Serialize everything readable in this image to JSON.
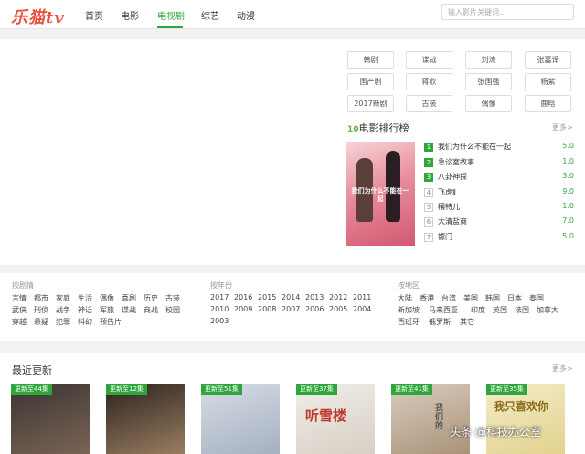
{
  "header": {
    "logo": "乐猫tv",
    "nav": [
      "首页",
      "电影",
      "电视剧",
      "综艺",
      "动漫"
    ],
    "active_nav": "电视剧",
    "search_placeholder": "输入影片关键词..."
  },
  "tags": [
    "韩剧",
    "谍战",
    "刘涛",
    "张嘉译",
    "国产剧",
    "蒋欣",
    "张国强",
    "杨紫",
    "2017新剧",
    "古装",
    "偶像",
    "鹿晗"
  ],
  "ranking": {
    "logo": "10",
    "title": "电影排行榜",
    "more": "更多>",
    "poster_text": "我们为什么不能在一起",
    "items": [
      {
        "num": "1",
        "name": "我们为什么不能在一起",
        "score": "5.0"
      },
      {
        "num": "2",
        "name": "急诊室故事",
        "score": "1.0"
      },
      {
        "num": "3",
        "name": "八卦神探",
        "score": "3.0"
      },
      {
        "num": "4",
        "name": "飞虎Ⅱ",
        "score": "9.0"
      },
      {
        "num": "5",
        "name": "穰特儿",
        "score": "1.0"
      },
      {
        "num": "6",
        "name": "大清盐商",
        "score": "7.0"
      },
      {
        "num": "7",
        "name": "镖门",
        "score": "5.0"
      }
    ]
  },
  "filters": {
    "by_genre": {
      "title": "按剧情",
      "rows": [
        [
          "言情",
          "都市",
          "家庭",
          "生活",
          "偶像",
          "喜剧",
          "历史",
          "古装"
        ],
        [
          "武侠",
          "刑侦",
          "战争",
          "神话",
          "军旅",
          "谍战",
          "商战",
          "校园"
        ],
        [
          "穿越",
          "悬疑",
          "犯罪",
          "科幻",
          "预告片"
        ]
      ]
    },
    "by_year": {
      "title": "按年份",
      "rows": [
        [
          "2017",
          "2016",
          "2015",
          "2014",
          "2013",
          "2012",
          "2011"
        ],
        [
          "2010",
          "2009",
          "2008",
          "2007",
          "2006",
          "2005",
          "2004"
        ],
        [
          "2003"
        ]
      ]
    },
    "by_region": {
      "title": "按地区",
      "rows": [
        [
          "大陆",
          "香港",
          "台湾",
          "美国",
          "韩国",
          "日本",
          "泰国"
        ],
        [
          "新加坡",
          "马来西亚",
          "印度",
          "英国",
          "法国",
          "加拿大"
        ],
        [
          "西班牙",
          "俄罗斯",
          "其它"
        ]
      ]
    }
  },
  "recent": {
    "title": "最近更新",
    "more": "更多>",
    "cards": [
      {
        "badge": "更新至44集",
        "colors": [
          "#3a3532",
          "#7a6455"
        ],
        "text": ""
      },
      {
        "badge": "更新至12集",
        "colors": [
          "#2b2320",
          "#9a7d60"
        ],
        "text": ""
      },
      {
        "badge": "更新至51集",
        "colors": [
          "#d8dde6",
          "#a5b0c0"
        ],
        "text": ""
      },
      {
        "badge": "更新至37集",
        "colors": [
          "#f1eee9",
          "#d6cfc4"
        ],
        "text": "听雪楼"
      },
      {
        "badge": "更新至41集",
        "colors": [
          "#d9cdbe",
          "#a99278"
        ],
        "text": "我们的"
      },
      {
        "badge": "更新至35集",
        "colors": [
          "#f4ecc8",
          "#e2d28f"
        ],
        "text": "我只喜欢你"
      }
    ]
  },
  "watermark": "头条 @科技办公室",
  "colors": {
    "accent": "#2fa63b",
    "logo": "#e8523f",
    "score": "#2fa63b"
  }
}
